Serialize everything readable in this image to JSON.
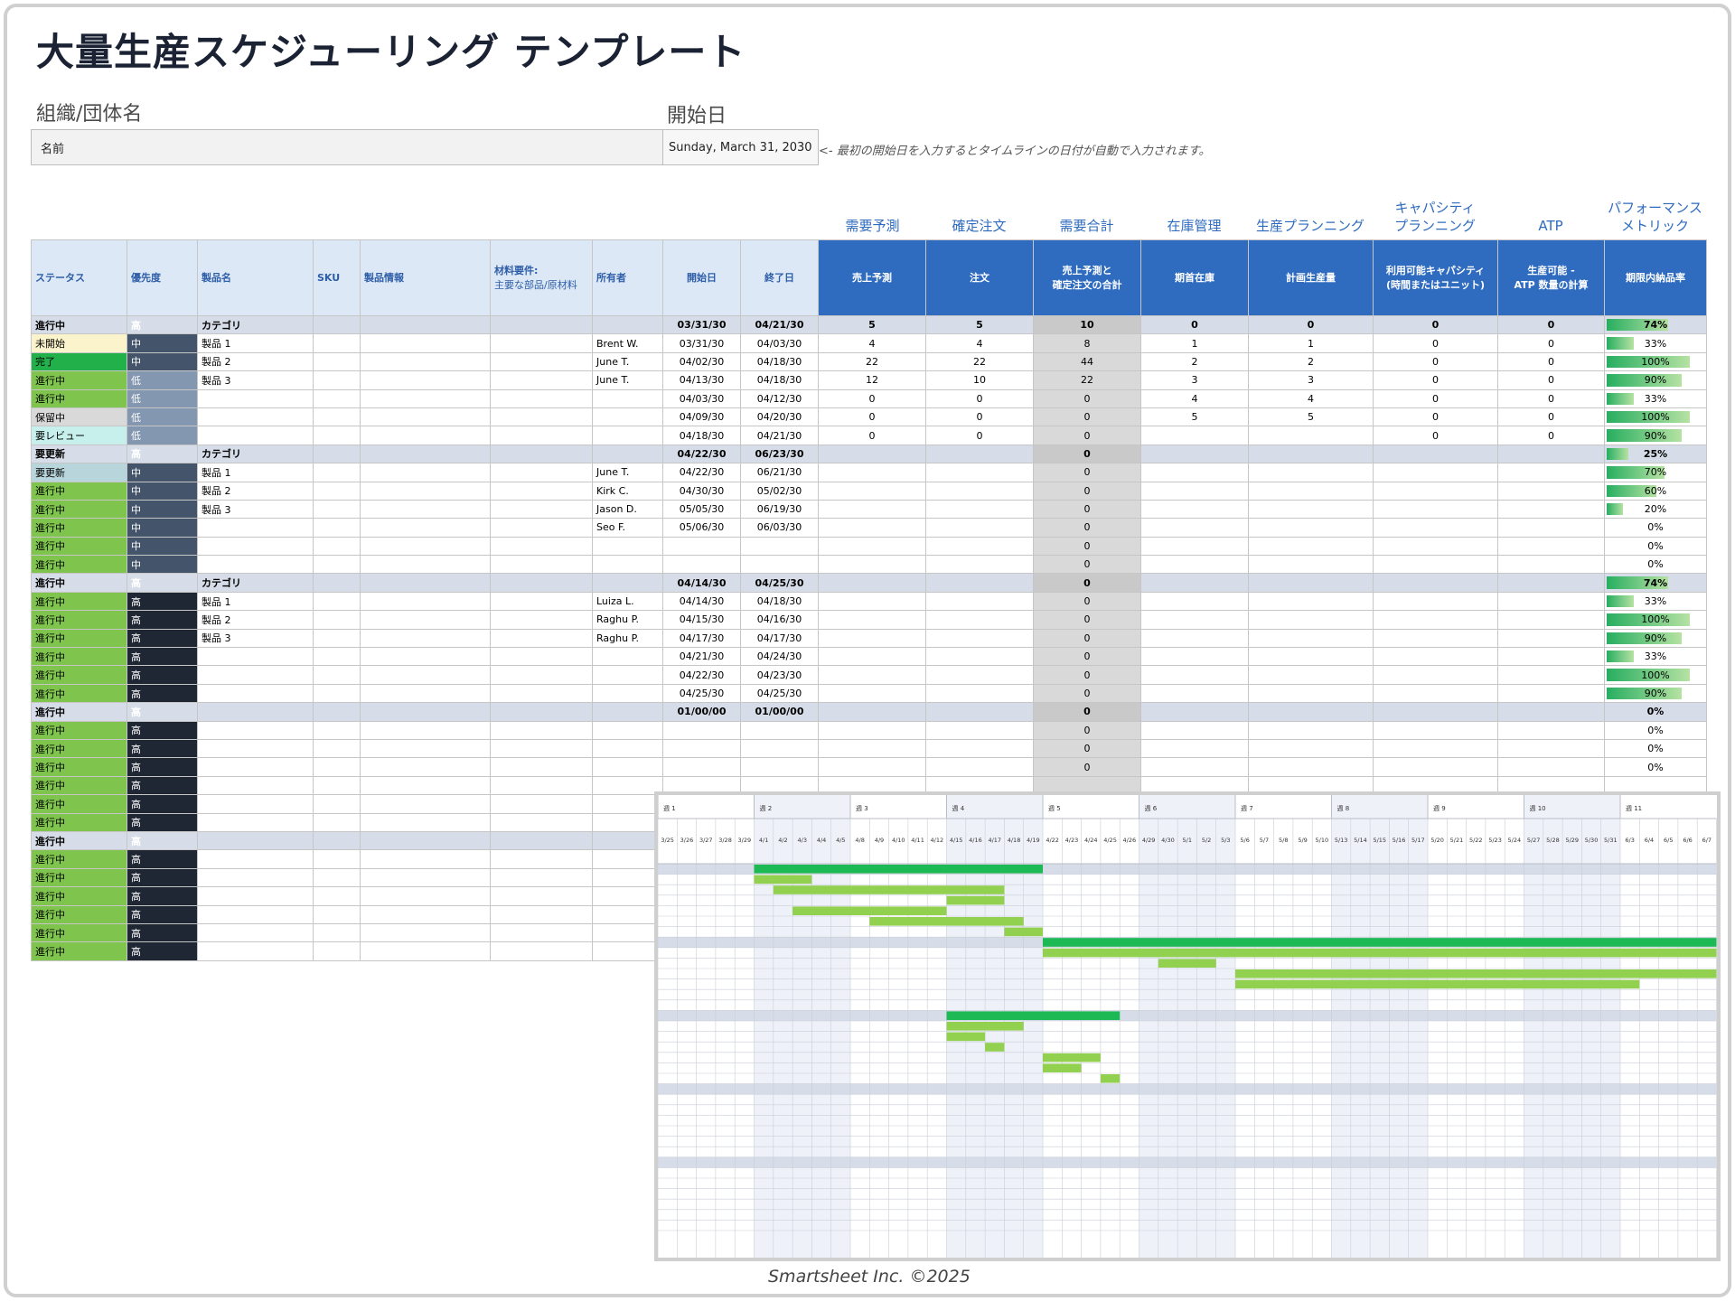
{
  "title": "大量生産スケジューリング テンプレート",
  "org": {
    "label": "組織/団体名",
    "value": "名前"
  },
  "start": {
    "label": "開始日",
    "value": "Sunday, March 31, 2030"
  },
  "hint": "<- 最初の開始日を入力するとタイムラインの日付が自動で入力されます。",
  "sections": [
    "需要予測",
    "確定注文",
    "需要合計",
    "在庫管理",
    "生産プランニング",
    "キャパシティ\nプランニング",
    "ATP",
    "パフォーマンス\nメトリック"
  ],
  "headers": {
    "status": "ステータス",
    "priority": "優先度",
    "product": "製品名",
    "sku": "SKU",
    "info": "製品情報",
    "materials": "材料要件:",
    "materials_sub": "主要な部品/原材料",
    "owner": "所有者",
    "start": "開始日",
    "end": "終了日",
    "forecast": "売上予測",
    "orders": "注文",
    "total": "売上予測と\n確定注文の合計",
    "inventory": "期首在庫",
    "planned": "計画生産量",
    "capacity": "利用可能キャパシティ\n(時間またはユニット)",
    "atp": "生産可能 -\nATP 数量の計算",
    "ontime": "期限内納品率"
  },
  "rows": [
    {
      "cat": true,
      "status": "進行中",
      "st": "prog",
      "priority": "高",
      "pr": "hi",
      "product": "カテゴリ",
      "owner": "",
      "start": "03/31/30",
      "end": "04/21/30",
      "forecast": "5",
      "orders": "5",
      "total": "10",
      "inventory": "0",
      "planned": "0",
      "capacity": "0",
      "atp": "0",
      "pct": "74%"
    },
    {
      "status": "未開始",
      "st": "ns",
      "priority": "中",
      "pr": "mid",
      "product": "製品 1",
      "owner": "Brent W.",
      "start": "03/31/30",
      "end": "04/03/30",
      "forecast": "4",
      "orders": "4",
      "total": "8",
      "inventory": "1",
      "planned": "1",
      "capacity": "0",
      "atp": "0",
      "pct": "33%"
    },
    {
      "status": "完了",
      "st": "done",
      "priority": "中",
      "pr": "mid",
      "product": "製品 2",
      "owner": "June T.",
      "start": "04/02/30",
      "end": "04/18/30",
      "forecast": "22",
      "orders": "22",
      "total": "44",
      "inventory": "2",
      "planned": "2",
      "capacity": "0",
      "atp": "0",
      "pct": "100%"
    },
    {
      "status": "進行中",
      "st": "prog",
      "priority": "低",
      "pr": "lo",
      "product": "製品 3",
      "owner": "June T.",
      "start": "04/13/30",
      "end": "04/18/30",
      "forecast": "12",
      "orders": "10",
      "total": "22",
      "inventory": "3",
      "planned": "3",
      "capacity": "0",
      "atp": "0",
      "pct": "90%"
    },
    {
      "status": "進行中",
      "st": "prog",
      "priority": "低",
      "pr": "lo",
      "product": "",
      "owner": "",
      "start": "04/03/30",
      "end": "04/12/30",
      "forecast": "0",
      "orders": "0",
      "total": "0",
      "inventory": "4",
      "planned": "4",
      "capacity": "0",
      "atp": "0",
      "pct": "33%"
    },
    {
      "status": "保留中",
      "st": "hold",
      "priority": "低",
      "pr": "lo",
      "product": "",
      "owner": "",
      "start": "04/09/30",
      "end": "04/20/30",
      "forecast": "0",
      "orders": "0",
      "total": "0",
      "inventory": "5",
      "planned": "5",
      "capacity": "0",
      "atp": "0",
      "pct": "100%"
    },
    {
      "status": "要レビュー",
      "st": "rev",
      "priority": "低",
      "pr": "lo",
      "product": "",
      "owner": "",
      "start": "04/18/30",
      "end": "04/21/30",
      "forecast": "0",
      "orders": "0",
      "total": "0",
      "inventory": "",
      "planned": "",
      "capacity": "0",
      "atp": "0",
      "pct": "90%"
    },
    {
      "cat": true,
      "status": "要更新",
      "st": "upd",
      "priority": "高",
      "pr": "hi",
      "product": "カテゴリ",
      "owner": "",
      "start": "04/22/30",
      "end": "06/23/30",
      "forecast": "",
      "orders": "",
      "total": "0",
      "inventory": "",
      "planned": "",
      "capacity": "",
      "atp": "",
      "pct": "25%"
    },
    {
      "status": "要更新",
      "st": "upd",
      "priority": "中",
      "pr": "mid",
      "product": "製品 1",
      "owner": "June T.",
      "start": "04/22/30",
      "end": "06/21/30",
      "forecast": "",
      "orders": "",
      "total": "0",
      "inventory": "",
      "planned": "",
      "capacity": "",
      "atp": "",
      "pct": "70%"
    },
    {
      "status": "進行中",
      "st": "prog",
      "priority": "中",
      "pr": "mid",
      "product": "製品 2",
      "owner": "Kirk C.",
      "start": "04/30/30",
      "end": "05/02/30",
      "forecast": "",
      "orders": "",
      "total": "0",
      "inventory": "",
      "planned": "",
      "capacity": "",
      "atp": "",
      "pct": "60%"
    },
    {
      "status": "進行中",
      "st": "prog",
      "priority": "中",
      "pr": "mid",
      "product": "製品 3",
      "owner": "Jason D.",
      "start": "05/05/30",
      "end": "06/19/30",
      "forecast": "",
      "orders": "",
      "total": "0",
      "inventory": "",
      "planned": "",
      "capacity": "",
      "atp": "",
      "pct": "20%"
    },
    {
      "status": "進行中",
      "st": "prog",
      "priority": "中",
      "pr": "mid",
      "product": "",
      "owner": "Seo F.",
      "start": "05/06/30",
      "end": "06/03/30",
      "forecast": "",
      "orders": "",
      "total": "0",
      "inventory": "",
      "planned": "",
      "capacity": "",
      "atp": "",
      "pct": "0%"
    },
    {
      "status": "進行中",
      "st": "prog",
      "priority": "中",
      "pr": "mid",
      "product": "",
      "owner": "",
      "start": "",
      "end": "",
      "forecast": "",
      "orders": "",
      "total": "0",
      "inventory": "",
      "planned": "",
      "capacity": "",
      "atp": "",
      "pct": "0%"
    },
    {
      "status": "進行中",
      "st": "prog",
      "priority": "中",
      "pr": "mid",
      "product": "",
      "owner": "",
      "start": "",
      "end": "",
      "forecast": "",
      "orders": "",
      "total": "0",
      "inventory": "",
      "planned": "",
      "capacity": "",
      "atp": "",
      "pct": "0%"
    },
    {
      "cat": true,
      "status": "進行中",
      "st": "prog",
      "priority": "高",
      "pr": "hi",
      "product": "カテゴリ",
      "owner": "",
      "start": "04/14/30",
      "end": "04/25/30",
      "forecast": "",
      "orders": "",
      "total": "0",
      "inventory": "",
      "planned": "",
      "capacity": "",
      "atp": "",
      "pct": "74%"
    },
    {
      "status": "進行中",
      "st": "prog",
      "priority": "高",
      "pr": "hi",
      "product": "製品 1",
      "owner": "Luiza L.",
      "start": "04/14/30",
      "end": "04/18/30",
      "forecast": "",
      "orders": "",
      "total": "0",
      "inventory": "",
      "planned": "",
      "capacity": "",
      "atp": "",
      "pct": "33%"
    },
    {
      "status": "進行中",
      "st": "prog",
      "priority": "高",
      "pr": "hi",
      "product": "製品 2",
      "owner": "Raghu P.",
      "start": "04/15/30",
      "end": "04/16/30",
      "forecast": "",
      "orders": "",
      "total": "0",
      "inventory": "",
      "planned": "",
      "capacity": "",
      "atp": "",
      "pct": "100%"
    },
    {
      "status": "進行中",
      "st": "prog",
      "priority": "高",
      "pr": "hi",
      "product": "製品 3",
      "owner": "Raghu P.",
      "start": "04/17/30",
      "end": "04/17/30",
      "forecast": "",
      "orders": "",
      "total": "0",
      "inventory": "",
      "planned": "",
      "capacity": "",
      "atp": "",
      "pct": "90%"
    },
    {
      "status": "進行中",
      "st": "prog",
      "priority": "高",
      "pr": "hi",
      "product": "",
      "owner": "",
      "start": "04/21/30",
      "end": "04/24/30",
      "forecast": "",
      "orders": "",
      "total": "0",
      "inventory": "",
      "planned": "",
      "capacity": "",
      "atp": "",
      "pct": "33%"
    },
    {
      "status": "進行中",
      "st": "prog",
      "priority": "高",
      "pr": "hi",
      "product": "",
      "owner": "",
      "start": "04/22/30",
      "end": "04/23/30",
      "forecast": "",
      "orders": "",
      "total": "0",
      "inventory": "",
      "planned": "",
      "capacity": "",
      "atp": "",
      "pct": "100%"
    },
    {
      "status": "進行中",
      "st": "prog",
      "priority": "高",
      "pr": "hi",
      "product": "",
      "owner": "",
      "start": "04/25/30",
      "end": "04/25/30",
      "forecast": "",
      "orders": "",
      "total": "0",
      "inventory": "",
      "planned": "",
      "capacity": "",
      "atp": "",
      "pct": "90%"
    },
    {
      "cat": true,
      "status": "進行中",
      "st": "prog",
      "priority": "高",
      "pr": "hi",
      "product": "",
      "owner": "",
      "start": "01/00/00",
      "end": "01/00/00",
      "forecast": "",
      "orders": "",
      "total": "0",
      "inventory": "",
      "planned": "",
      "capacity": "",
      "atp": "",
      "pct": "0%"
    },
    {
      "status": "進行中",
      "st": "prog",
      "priority": "高",
      "pr": "hi",
      "product": "",
      "owner": "",
      "start": "",
      "end": "",
      "forecast": "",
      "orders": "",
      "total": "0",
      "inventory": "",
      "planned": "",
      "capacity": "",
      "atp": "",
      "pct": "0%"
    },
    {
      "status": "進行中",
      "st": "prog",
      "priority": "高",
      "pr": "hi",
      "product": "",
      "owner": "",
      "start": "",
      "end": "",
      "forecast": "",
      "orders": "",
      "total": "0",
      "inventory": "",
      "planned": "",
      "capacity": "",
      "atp": "",
      "pct": "0%"
    },
    {
      "status": "進行中",
      "st": "prog",
      "priority": "高",
      "pr": "hi",
      "product": "",
      "owner": "",
      "start": "",
      "end": "",
      "forecast": "",
      "orders": "",
      "total": "0",
      "inventory": "",
      "planned": "",
      "capacity": "",
      "atp": "",
      "pct": "0%"
    },
    {
      "status": "進行中",
      "st": "prog",
      "priority": "高",
      "pr": "hi",
      "product": "",
      "owner": "",
      "start": "",
      "end": "",
      "forecast": "",
      "orders": "",
      "total": "",
      "inventory": "",
      "planned": "",
      "capacity": "",
      "atp": "",
      "pct": ""
    },
    {
      "status": "進行中",
      "st": "prog",
      "priority": "高",
      "pr": "hi",
      "product": "",
      "owner": "",
      "start": "",
      "end": "",
      "forecast": "",
      "orders": "",
      "total": "",
      "inventory": "",
      "planned": "",
      "capacity": "",
      "atp": "",
      "pct": ""
    },
    {
      "status": "進行中",
      "st": "prog",
      "priority": "高",
      "pr": "hi",
      "product": "",
      "owner": "",
      "start": "",
      "end": "",
      "forecast": "",
      "orders": "",
      "total": "",
      "inventory": "",
      "planned": "",
      "capacity": "",
      "atp": "",
      "pct": ""
    },
    {
      "cat": true,
      "status": "進行中",
      "st": "prog",
      "priority": "高",
      "pr": "hi",
      "product": "",
      "owner": "",
      "start": "",
      "end": "",
      "forecast": "",
      "orders": "",
      "total": "",
      "inventory": "",
      "planned": "",
      "capacity": "",
      "atp": "",
      "pct": ""
    },
    {
      "status": "進行中",
      "st": "prog",
      "priority": "高",
      "pr": "hi",
      "product": "",
      "owner": "",
      "start": "",
      "end": "",
      "forecast": "",
      "orders": "",
      "total": "",
      "inventory": "",
      "planned": "",
      "capacity": "",
      "atp": "",
      "pct": ""
    },
    {
      "status": "進行中",
      "st": "prog",
      "priority": "高",
      "pr": "hi",
      "product": "",
      "owner": "",
      "start": "",
      "end": "",
      "forecast": "",
      "orders": "",
      "total": "",
      "inventory": "",
      "planned": "",
      "capacity": "",
      "atp": "",
      "pct": ""
    },
    {
      "status": "進行中",
      "st": "prog",
      "priority": "高",
      "pr": "hi",
      "product": "",
      "owner": "",
      "start": "",
      "end": "",
      "forecast": "",
      "orders": "",
      "total": "",
      "inventory": "",
      "planned": "",
      "capacity": "",
      "atp": "",
      "pct": ""
    },
    {
      "status": "進行中",
      "st": "prog",
      "priority": "高",
      "pr": "hi",
      "product": "",
      "owner": "",
      "start": "",
      "end": "",
      "forecast": "",
      "orders": "",
      "total": "",
      "inventory": "",
      "planned": "",
      "capacity": "",
      "atp": "",
      "pct": ""
    },
    {
      "status": "進行中",
      "st": "prog",
      "priority": "高",
      "pr": "hi",
      "product": "",
      "owner": "",
      "start": "",
      "end": "",
      "forecast": "",
      "orders": "",
      "total": "",
      "inventory": "",
      "planned": "",
      "capacity": "",
      "atp": "",
      "pct": ""
    },
    {
      "status": "進行中",
      "st": "prog",
      "priority": "高",
      "pr": "hi",
      "product": "",
      "owner": "",
      "start": "",
      "end": "",
      "forecast": "",
      "orders": "",
      "total": "",
      "inventory": "",
      "planned": "",
      "capacity": "",
      "atp": "",
      "pct": ""
    }
  ],
  "gantt": {
    "weeks": [
      "週 1",
      "週 2",
      "週 3",
      "週 4",
      "週 5",
      "週 6",
      "週 7",
      "週 8",
      "週 9",
      "週 10",
      "週 11"
    ],
    "days": [
      "3/25",
      "3/26",
      "3/27",
      "3/28",
      "3/29",
      "4/1",
      "4/2",
      "4/3",
      "4/4",
      "4/5",
      "4/8",
      "4/9",
      "4/10",
      "4/11",
      "4/12",
      "4/15",
      "4/16",
      "4/17",
      "4/18",
      "4/19",
      "4/22",
      "4/23",
      "4/24",
      "4/25",
      "4/26",
      "4/29",
      "4/30",
      "5/1",
      "5/2",
      "5/3",
      "5/6",
      "5/7",
      "5/8",
      "5/9",
      "5/10",
      "5/13",
      "5/14",
      "5/15",
      "5/16",
      "5/17",
      "5/20",
      "5/21",
      "5/22",
      "5/23",
      "5/24",
      "5/27",
      "5/28",
      "5/29",
      "5/30",
      "5/31",
      "6/3",
      "6/4",
      "6/5",
      "6/6",
      "6/7"
    ],
    "category_color": "#1db954",
    "task_color": "#92d050",
    "bars": [
      {
        "row": 0,
        "start": 5,
        "end": 20,
        "cat": true
      },
      {
        "row": 1,
        "start": 5,
        "end": 8
      },
      {
        "row": 2,
        "start": 6,
        "end": 18
      },
      {
        "row": 3,
        "start": 15,
        "end": 18
      },
      {
        "row": 4,
        "start": 7,
        "end": 15
      },
      {
        "row": 5,
        "start": 11,
        "end": 19
      },
      {
        "row": 6,
        "start": 18,
        "end": 20
      },
      {
        "row": 7,
        "start": 20,
        "end": 55,
        "cat": true
      },
      {
        "row": 8,
        "start": 20,
        "end": 55
      },
      {
        "row": 9,
        "start": 26,
        "end": 29
      },
      {
        "row": 10,
        "start": 30,
        "end": 55
      },
      {
        "row": 11,
        "start": 30,
        "end": 51
      },
      {
        "row": 14,
        "start": 15,
        "end": 24,
        "cat": true
      },
      {
        "row": 15,
        "start": 15,
        "end": 19
      },
      {
        "row": 16,
        "start": 15,
        "end": 17
      },
      {
        "row": 17,
        "start": 17,
        "end": 18
      },
      {
        "row": 18,
        "start": 20,
        "end": 23
      },
      {
        "row": 19,
        "start": 20,
        "end": 22
      },
      {
        "row": 20,
        "start": 23,
        "end": 24
      }
    ]
  },
  "footer": "Smartsheet Inc. ©2025"
}
